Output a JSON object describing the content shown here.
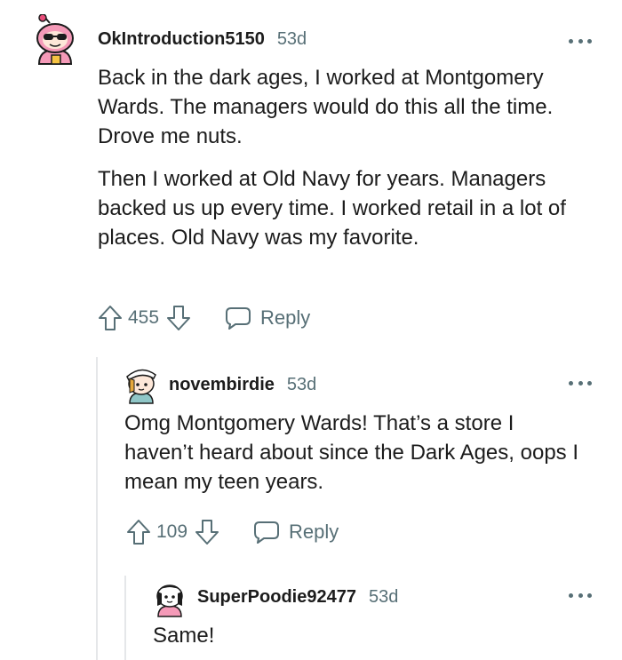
{
  "comments": [
    {
      "username": "OkIntroduction5150",
      "age": "53d",
      "paragraphs": [
        "Back in the dark ages, I worked at Montgomery Wards. The managers would do this all the time. Drove me nuts.",
        "Then I worked at Old Navy for years. Managers backed us up every time. I worked retail in a lot of places. Old Navy was my favorite."
      ],
      "score": "455",
      "reply_label": "Reply",
      "avatar_icon": "snoo-avatar-pink-sunglasses"
    },
    {
      "username": "novembirdie",
      "age": "53d",
      "paragraphs": [
        "Omg Montgomery Wards! That’s a store I haven’t heard about since the Dark Ages, oops I mean my teen years."
      ],
      "score": "109",
      "reply_label": "Reply",
      "avatar_icon": "snoo-avatar-hat"
    },
    {
      "username": "SuperPoodie92477",
      "age": "53d",
      "paragraphs": [
        "Same!"
      ],
      "avatar_icon": "snoo-avatar-pink"
    }
  ],
  "icons": {
    "upvote": "upvote-icon",
    "downvote": "downvote-icon",
    "reply": "reply-icon",
    "more": "more-options-icon"
  },
  "colors": {
    "text": "#1c1c1c",
    "meta": "#576f76",
    "thread_line": "#e5e7e9",
    "background": "#ffffff"
  }
}
